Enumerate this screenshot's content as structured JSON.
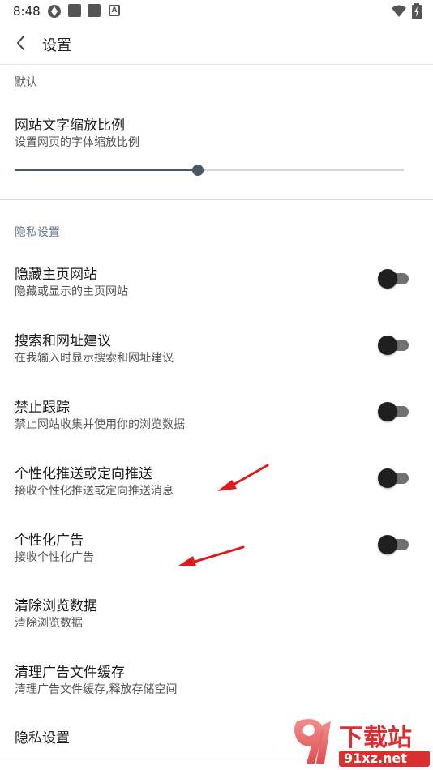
{
  "status_bar": {
    "time": "8:48"
  },
  "app_bar": {
    "title": "设置"
  },
  "sections": {
    "default_label": "默认",
    "privacy_label": "隐私设置"
  },
  "text_scale": {
    "title": "网站文字缩放比例",
    "subtitle": "设置网页的字体缩放比例",
    "value_fraction": 0.47
  },
  "rows": [
    {
      "title": "隐藏主页网站",
      "subtitle": "隐藏或显示的主页网站",
      "toggle": false
    },
    {
      "title": "搜索和网址建议",
      "subtitle": "在我输入时显示搜索和网址建议",
      "toggle": false
    },
    {
      "title": "禁止跟踪",
      "subtitle": "禁止网站收集并使用你的浏览数据",
      "toggle": false
    },
    {
      "title": "个性化推送或定向推送",
      "subtitle": "接收个性化推送或定向推送消息",
      "toggle": false
    },
    {
      "title": "个性化广告",
      "subtitle": "接收个性化广告",
      "toggle": false
    },
    {
      "title": "清除浏览数据",
      "subtitle": "清除浏览数据"
    },
    {
      "title": "清理广告文件缓存",
      "subtitle": "清理广告文件缓存,释放存储空间"
    },
    {
      "title": "隐私设置"
    }
  ],
  "colors": {
    "annotation_arrow": "#e01a1a",
    "slider_active": "#4a5766",
    "toggle_thumb": "#1f1f1f"
  },
  "watermark": {
    "text_main": "下载站",
    "text_domain": "91xz.net"
  }
}
